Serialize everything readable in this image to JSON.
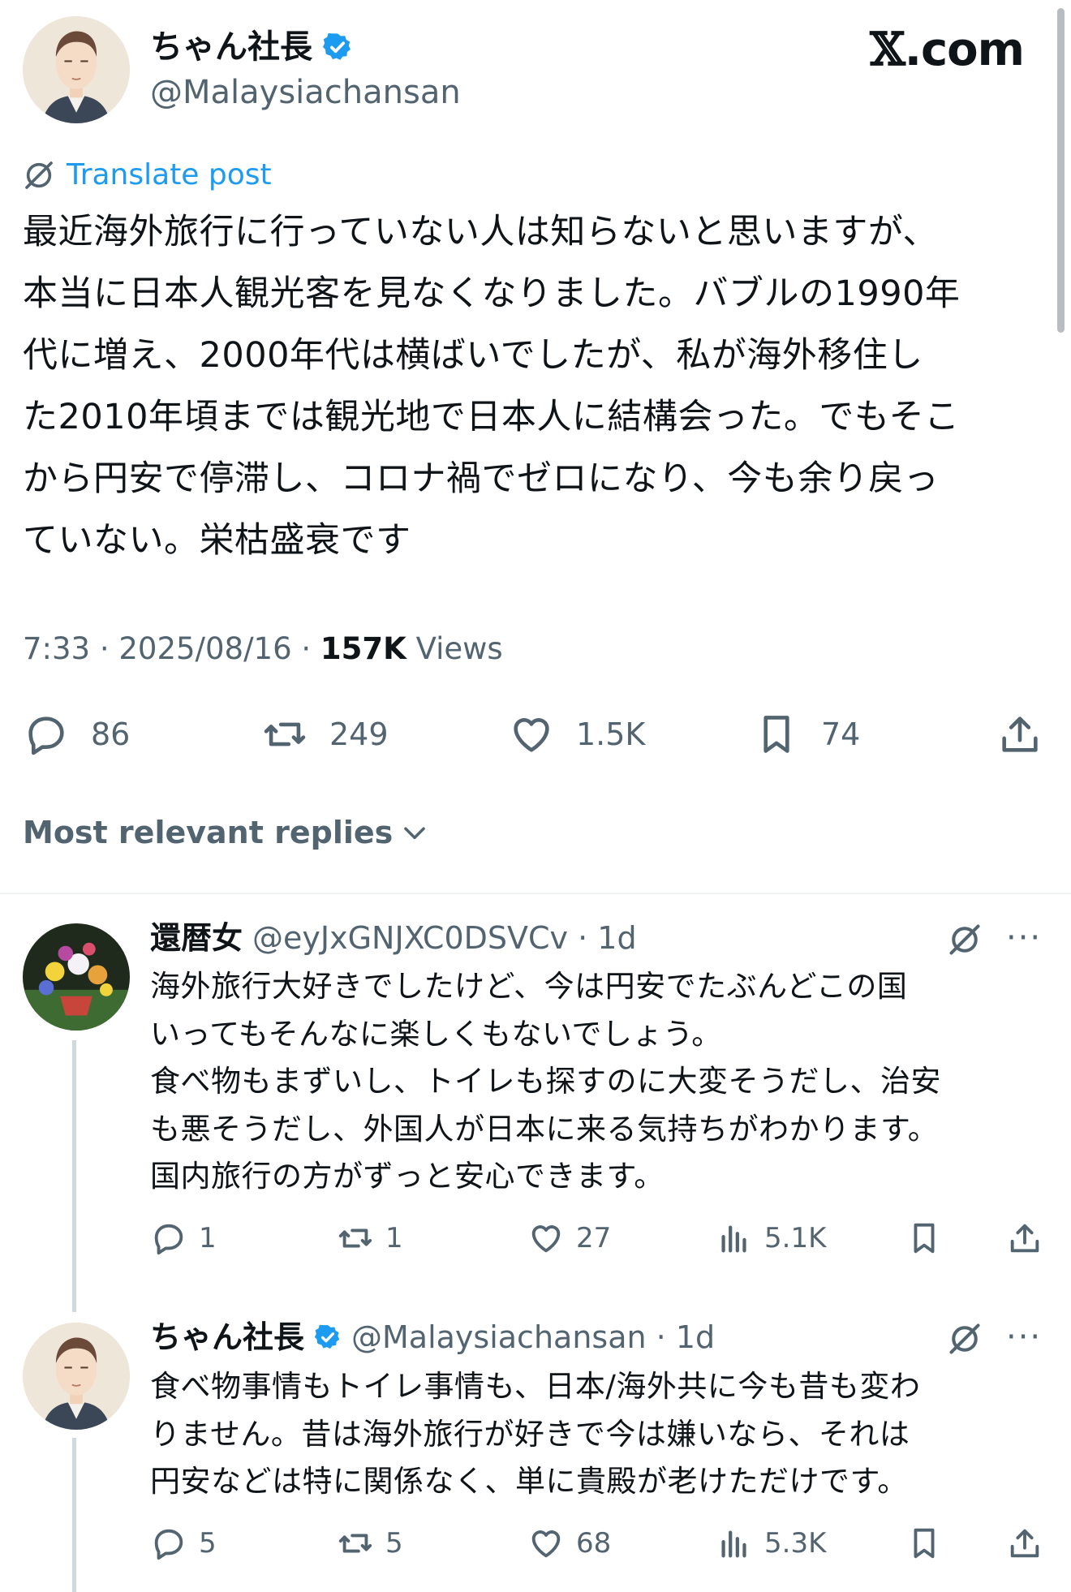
{
  "header": {
    "display_name": "ちゃん社長",
    "handle": "@Malaysiachansan",
    "brand": {
      "x": "𝕏",
      "dotcom": ".com"
    }
  },
  "post": {
    "translate_label": "Translate post",
    "text": "最近海外旅行に行っていない人は知らないと思いますが、\n本当に日本人観光客を見なくなりました。バブルの1990年\n代に増え、2000年代は横ばいでしたが、私が海外移住し\nた2010年頃までは観光地で日本人に結構会った。でもそこ\nから円安で停滞し、コロナ禍でゼロになり、今も余り戻っ\nていない。栄枯盛衰です",
    "time": "7:33 · 2025/08/16 · ",
    "views_count": "157K",
    "views_label": " Views",
    "actions": {
      "replies": "86",
      "reposts": "249",
      "likes": "1.5K",
      "bookmarks": "74"
    }
  },
  "sort_label": "Most relevant replies",
  "replies": [
    {
      "name": "還暦女",
      "handle": "@eyJxGNJXC0DSVCv · 1d",
      "text": "海外旅行大好きでしたけど、今は円安でたぶんどこの国\nいってもそんなに楽しくもないでしょう。\n食べ物もまずいし、トイレも探すのに大変そうだし、治安\nも悪そうだし、外国人が日本に来る気持ちがわかります。\n国内旅行の方がずっと安心できます。",
      "replies": "1",
      "reposts": "1",
      "likes": "27",
      "views": "5.1K"
    },
    {
      "name": "ちゃん社長",
      "handle": "@Malaysiachansan · 1d",
      "text": "食べ物事情もトイレ事情も、日本/海外共に今も昔も変わ\nりません。昔は海外旅行が好きで今は嫌いなら、それは\n円安などは特に関係なく、単に貴殿が老けただけです。",
      "replies": "5",
      "reposts": "5",
      "likes": "68",
      "views": "5.3K"
    }
  ],
  "more_label": "···",
  "colors": {
    "verified": "#1d9bf0",
    "link": "#1d9bf0",
    "secondary": "#536471",
    "text": "#0f1419"
  }
}
